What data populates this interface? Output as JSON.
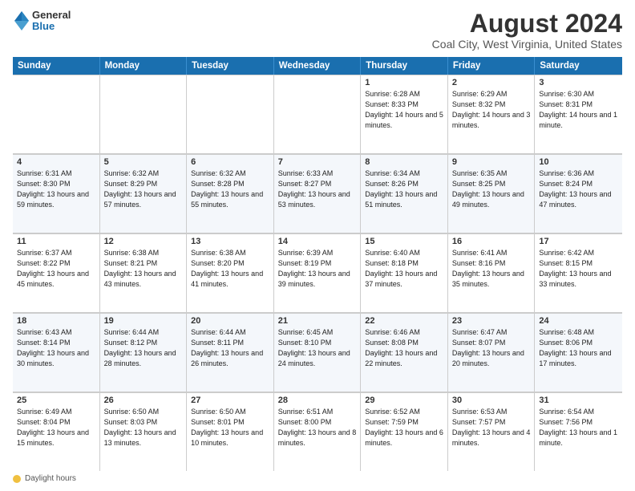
{
  "header": {
    "logo": {
      "general": "General",
      "blue": "Blue"
    },
    "title": "August 2024",
    "location": "Coal City, West Virginia, United States"
  },
  "calendar": {
    "day_headers": [
      "Sunday",
      "Monday",
      "Tuesday",
      "Wednesday",
      "Thursday",
      "Friday",
      "Saturday"
    ],
    "rows": [
      [
        {
          "day": "",
          "info": ""
        },
        {
          "day": "",
          "info": ""
        },
        {
          "day": "",
          "info": ""
        },
        {
          "day": "",
          "info": ""
        },
        {
          "day": "1",
          "info": "Sunrise: 6:28 AM\nSunset: 8:33 PM\nDaylight: 14 hours\nand 5 minutes."
        },
        {
          "day": "2",
          "info": "Sunrise: 6:29 AM\nSunset: 8:32 PM\nDaylight: 14 hours\nand 3 minutes."
        },
        {
          "day": "3",
          "info": "Sunrise: 6:30 AM\nSunset: 8:31 PM\nDaylight: 14 hours\nand 1 minute."
        }
      ],
      [
        {
          "day": "4",
          "info": "Sunrise: 6:31 AM\nSunset: 8:30 PM\nDaylight: 13 hours\nand 59 minutes."
        },
        {
          "day": "5",
          "info": "Sunrise: 6:32 AM\nSunset: 8:29 PM\nDaylight: 13 hours\nand 57 minutes."
        },
        {
          "day": "6",
          "info": "Sunrise: 6:32 AM\nSunset: 8:28 PM\nDaylight: 13 hours\nand 55 minutes."
        },
        {
          "day": "7",
          "info": "Sunrise: 6:33 AM\nSunset: 8:27 PM\nDaylight: 13 hours\nand 53 minutes."
        },
        {
          "day": "8",
          "info": "Sunrise: 6:34 AM\nSunset: 8:26 PM\nDaylight: 13 hours\nand 51 minutes."
        },
        {
          "day": "9",
          "info": "Sunrise: 6:35 AM\nSunset: 8:25 PM\nDaylight: 13 hours\nand 49 minutes."
        },
        {
          "day": "10",
          "info": "Sunrise: 6:36 AM\nSunset: 8:24 PM\nDaylight: 13 hours\nand 47 minutes."
        }
      ],
      [
        {
          "day": "11",
          "info": "Sunrise: 6:37 AM\nSunset: 8:22 PM\nDaylight: 13 hours\nand 45 minutes."
        },
        {
          "day": "12",
          "info": "Sunrise: 6:38 AM\nSunset: 8:21 PM\nDaylight: 13 hours\nand 43 minutes."
        },
        {
          "day": "13",
          "info": "Sunrise: 6:38 AM\nSunset: 8:20 PM\nDaylight: 13 hours\nand 41 minutes."
        },
        {
          "day": "14",
          "info": "Sunrise: 6:39 AM\nSunset: 8:19 PM\nDaylight: 13 hours\nand 39 minutes."
        },
        {
          "day": "15",
          "info": "Sunrise: 6:40 AM\nSunset: 8:18 PM\nDaylight: 13 hours\nand 37 minutes."
        },
        {
          "day": "16",
          "info": "Sunrise: 6:41 AM\nSunset: 8:16 PM\nDaylight: 13 hours\nand 35 minutes."
        },
        {
          "day": "17",
          "info": "Sunrise: 6:42 AM\nSunset: 8:15 PM\nDaylight: 13 hours\nand 33 minutes."
        }
      ],
      [
        {
          "day": "18",
          "info": "Sunrise: 6:43 AM\nSunset: 8:14 PM\nDaylight: 13 hours\nand 30 minutes."
        },
        {
          "day": "19",
          "info": "Sunrise: 6:44 AM\nSunset: 8:12 PM\nDaylight: 13 hours\nand 28 minutes."
        },
        {
          "day": "20",
          "info": "Sunrise: 6:44 AM\nSunset: 8:11 PM\nDaylight: 13 hours\nand 26 minutes."
        },
        {
          "day": "21",
          "info": "Sunrise: 6:45 AM\nSunset: 8:10 PM\nDaylight: 13 hours\nand 24 minutes."
        },
        {
          "day": "22",
          "info": "Sunrise: 6:46 AM\nSunset: 8:08 PM\nDaylight: 13 hours\nand 22 minutes."
        },
        {
          "day": "23",
          "info": "Sunrise: 6:47 AM\nSunset: 8:07 PM\nDaylight: 13 hours\nand 20 minutes."
        },
        {
          "day": "24",
          "info": "Sunrise: 6:48 AM\nSunset: 8:06 PM\nDaylight: 13 hours\nand 17 minutes."
        }
      ],
      [
        {
          "day": "25",
          "info": "Sunrise: 6:49 AM\nSunset: 8:04 PM\nDaylight: 13 hours\nand 15 minutes."
        },
        {
          "day": "26",
          "info": "Sunrise: 6:50 AM\nSunset: 8:03 PM\nDaylight: 13 hours\nand 13 minutes."
        },
        {
          "day": "27",
          "info": "Sunrise: 6:50 AM\nSunset: 8:01 PM\nDaylight: 13 hours\nand 10 minutes."
        },
        {
          "day": "28",
          "info": "Sunrise: 6:51 AM\nSunset: 8:00 PM\nDaylight: 13 hours\nand 8 minutes."
        },
        {
          "day": "29",
          "info": "Sunrise: 6:52 AM\nSunset: 7:59 PM\nDaylight: 13 hours\nand 6 minutes."
        },
        {
          "day": "30",
          "info": "Sunrise: 6:53 AM\nSunset: 7:57 PM\nDaylight: 13 hours\nand 4 minutes."
        },
        {
          "day": "31",
          "info": "Sunrise: 6:54 AM\nSunset: 7:56 PM\nDaylight: 13 hours\nand 1 minute."
        }
      ]
    ]
  },
  "footer": {
    "daylight_label": "Daylight hours"
  },
  "colors": {
    "header_bg": "#1a6faf",
    "row_alt": "#f0f4f8",
    "border": "#cccccc"
  }
}
